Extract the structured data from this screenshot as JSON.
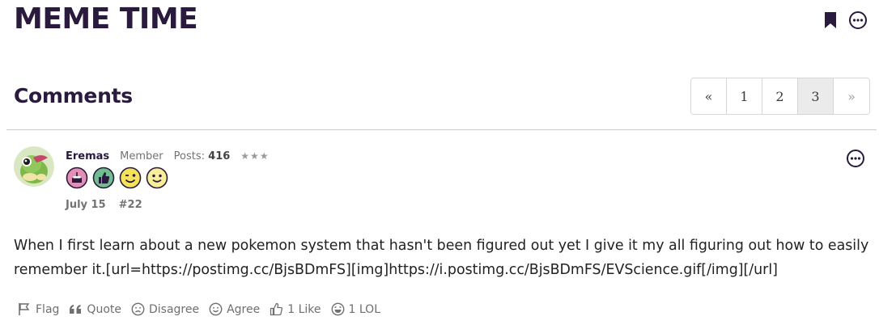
{
  "discussion": {
    "title": "MEME TIME"
  },
  "comments_section": {
    "heading": "Comments"
  },
  "pagination": {
    "prev": "«",
    "pages": [
      "1",
      "2",
      "3"
    ],
    "current_page": "3",
    "next": "»"
  },
  "comment": {
    "author": "Eremas",
    "role": "Member",
    "posts_label": "Posts:",
    "posts_count": "416",
    "rank_stars": "★★★",
    "badges": [
      "cake-badge",
      "thumbs-up-badge",
      "wink-badge",
      "smile-badge"
    ],
    "date": "July 15",
    "number": "#22",
    "body": "When I first learn about a new pokemon system that hasn't been figured out yet I give it my all figuring out how to easily remember it.[url=https://postimg.cc/BjsBDmFS][img]https://i.postimg.cc/BjsBDmFS/EVScience.gif[/img][/url]",
    "reactions": {
      "flag": "Flag",
      "quote": "Quote",
      "disagree": "Disagree",
      "agree": "Agree",
      "like": "1 Like",
      "lol": "1 LOL"
    }
  },
  "colors": {
    "title": "#2a1a3e",
    "muted": "#737373",
    "border": "#d6d6d6",
    "active_page": "#ebebeb"
  }
}
